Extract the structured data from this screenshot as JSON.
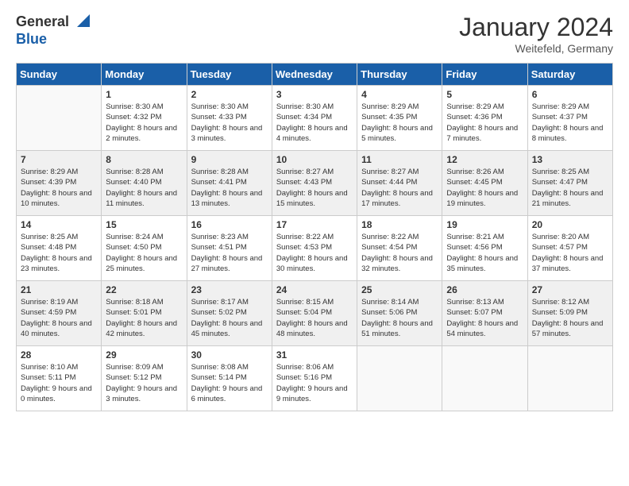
{
  "header": {
    "logo_general": "General",
    "logo_blue": "Blue",
    "main_title": "January 2024",
    "subtitle": "Weitefeld, Germany"
  },
  "days_of_week": [
    "Sunday",
    "Monday",
    "Tuesday",
    "Wednesday",
    "Thursday",
    "Friday",
    "Saturday"
  ],
  "weeks": [
    [
      {
        "day": "",
        "sunrise": "",
        "sunset": "",
        "daylight": "",
        "empty": true
      },
      {
        "day": "1",
        "sunrise": "8:30 AM",
        "sunset": "4:32 PM",
        "daylight": "8 hours and 2 minutes."
      },
      {
        "day": "2",
        "sunrise": "8:30 AM",
        "sunset": "4:33 PM",
        "daylight": "8 hours and 3 minutes."
      },
      {
        "day": "3",
        "sunrise": "8:30 AM",
        "sunset": "4:34 PM",
        "daylight": "8 hours and 4 minutes."
      },
      {
        "day": "4",
        "sunrise": "8:29 AM",
        "sunset": "4:35 PM",
        "daylight": "8 hours and 5 minutes."
      },
      {
        "day": "5",
        "sunrise": "8:29 AM",
        "sunset": "4:36 PM",
        "daylight": "8 hours and 7 minutes."
      },
      {
        "day": "6",
        "sunrise": "8:29 AM",
        "sunset": "4:37 PM",
        "daylight": "8 hours and 8 minutes."
      }
    ],
    [
      {
        "day": "7",
        "sunrise": "8:29 AM",
        "sunset": "4:39 PM",
        "daylight": "8 hours and 10 minutes."
      },
      {
        "day": "8",
        "sunrise": "8:28 AM",
        "sunset": "4:40 PM",
        "daylight": "8 hours and 11 minutes."
      },
      {
        "day": "9",
        "sunrise": "8:28 AM",
        "sunset": "4:41 PM",
        "daylight": "8 hours and 13 minutes."
      },
      {
        "day": "10",
        "sunrise": "8:27 AM",
        "sunset": "4:43 PM",
        "daylight": "8 hours and 15 minutes."
      },
      {
        "day": "11",
        "sunrise": "8:27 AM",
        "sunset": "4:44 PM",
        "daylight": "8 hours and 17 minutes."
      },
      {
        "day": "12",
        "sunrise": "8:26 AM",
        "sunset": "4:45 PM",
        "daylight": "8 hours and 19 minutes."
      },
      {
        "day": "13",
        "sunrise": "8:25 AM",
        "sunset": "4:47 PM",
        "daylight": "8 hours and 21 minutes."
      }
    ],
    [
      {
        "day": "14",
        "sunrise": "8:25 AM",
        "sunset": "4:48 PM",
        "daylight": "8 hours and 23 minutes."
      },
      {
        "day": "15",
        "sunrise": "8:24 AM",
        "sunset": "4:50 PM",
        "daylight": "8 hours and 25 minutes."
      },
      {
        "day": "16",
        "sunrise": "8:23 AM",
        "sunset": "4:51 PM",
        "daylight": "8 hours and 27 minutes."
      },
      {
        "day": "17",
        "sunrise": "8:22 AM",
        "sunset": "4:53 PM",
        "daylight": "8 hours and 30 minutes."
      },
      {
        "day": "18",
        "sunrise": "8:22 AM",
        "sunset": "4:54 PM",
        "daylight": "8 hours and 32 minutes."
      },
      {
        "day": "19",
        "sunrise": "8:21 AM",
        "sunset": "4:56 PM",
        "daylight": "8 hours and 35 minutes."
      },
      {
        "day": "20",
        "sunrise": "8:20 AM",
        "sunset": "4:57 PM",
        "daylight": "8 hours and 37 minutes."
      }
    ],
    [
      {
        "day": "21",
        "sunrise": "8:19 AM",
        "sunset": "4:59 PM",
        "daylight": "8 hours and 40 minutes."
      },
      {
        "day": "22",
        "sunrise": "8:18 AM",
        "sunset": "5:01 PM",
        "daylight": "8 hours and 42 minutes."
      },
      {
        "day": "23",
        "sunrise": "8:17 AM",
        "sunset": "5:02 PM",
        "daylight": "8 hours and 45 minutes."
      },
      {
        "day": "24",
        "sunrise": "8:15 AM",
        "sunset": "5:04 PM",
        "daylight": "8 hours and 48 minutes."
      },
      {
        "day": "25",
        "sunrise": "8:14 AM",
        "sunset": "5:06 PM",
        "daylight": "8 hours and 51 minutes."
      },
      {
        "day": "26",
        "sunrise": "8:13 AM",
        "sunset": "5:07 PM",
        "daylight": "8 hours and 54 minutes."
      },
      {
        "day": "27",
        "sunrise": "8:12 AM",
        "sunset": "5:09 PM",
        "daylight": "8 hours and 57 minutes."
      }
    ],
    [
      {
        "day": "28",
        "sunrise": "8:10 AM",
        "sunset": "5:11 PM",
        "daylight": "9 hours and 0 minutes."
      },
      {
        "day": "29",
        "sunrise": "8:09 AM",
        "sunset": "5:12 PM",
        "daylight": "9 hours and 3 minutes."
      },
      {
        "day": "30",
        "sunrise": "8:08 AM",
        "sunset": "5:14 PM",
        "daylight": "9 hours and 6 minutes."
      },
      {
        "day": "31",
        "sunrise": "8:06 AM",
        "sunset": "5:16 PM",
        "daylight": "9 hours and 9 minutes."
      },
      {
        "day": "",
        "sunrise": "",
        "sunset": "",
        "daylight": "",
        "empty": true
      },
      {
        "day": "",
        "sunrise": "",
        "sunset": "",
        "daylight": "",
        "empty": true
      },
      {
        "day": "",
        "sunrise": "",
        "sunset": "",
        "daylight": "",
        "empty": true
      }
    ]
  ],
  "labels": {
    "sunrise_label": "Sunrise:",
    "sunset_label": "Sunset:",
    "daylight_label": "Daylight:"
  }
}
